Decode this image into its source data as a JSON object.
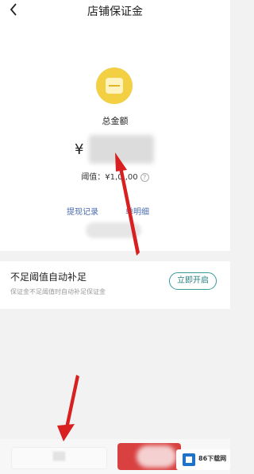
{
  "header": {
    "title": "店铺保证金"
  },
  "balance": {
    "total_label": "总金额",
    "currency_symbol": "¥",
    "threshold_text": "阈值：¥1,0  ,00"
  },
  "links": {
    "records": "提现记录",
    "details": "单明细"
  },
  "auto_topup": {
    "title": "不足阈值自动补足",
    "description": "保证金不足阈值时自动补足保证金",
    "enable_label": "立即开启"
  },
  "watermark": {
    "text": "86下载网"
  },
  "colors": {
    "accent": "#2a7f7f",
    "link": "#4a6bb0",
    "annotation_arrow": "#d82020",
    "coin": "#f2cf43",
    "primary_button": "#d94141"
  },
  "icons": {
    "back": "chevron-left-icon",
    "coin": "coin-icon",
    "help": "question-icon"
  }
}
